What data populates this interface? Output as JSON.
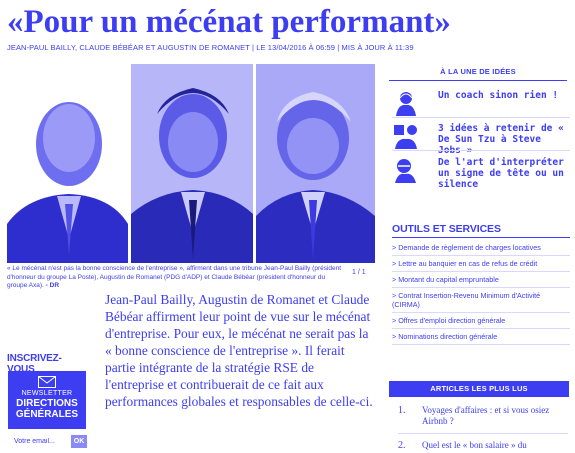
{
  "article": {
    "title": "«Pour un mécénat performant»",
    "authors": "JEAN-PAUL BAILLY, CLAUDE BÉBÉAR ET AUGUSTIN DE ROMANET |",
    "published": "LE 13/04/2016 À 06:59 | MIS À JOUR À 11:39",
    "caption": "« Le mécénat n'est pas la bonne conscience de l'entreprise », affirment dans une tribune Jean-Paul Bailly (président d'honneur du groupe La Poste), Augustin de Romanet (PDG d'ADP) et Claude Bébéar (président d'honneur du groupe Axa).",
    "caption_credit": "- DR",
    "photo_counter": "1 / 1",
    "body": "Jean-Paul Bailly, Augustin de Romanet et Claude Bébéar affirment leur point de vue sur le mécénat d'entreprise. Pour eux, le mécénat ne serait pas la « bonne conscience de l'entreprise ». Il ferait partie intégrante de la stratégie RSE de l'entreprise et contribuerait de ce fait aux performances globales et responsables de celle-ci."
  },
  "newsletter": {
    "heading": "INSCRIVEZ-VOUS",
    "label": "NEWSLETTER",
    "name_line1": "DIRECTIONS",
    "name_line2": "GÉNÉRALES",
    "placeholder": "Votre email...",
    "submit_label": "OK"
  },
  "ideas": {
    "heading": "À LA UNE DE IDÉES",
    "items": [
      {
        "title": "Un coach sinon rien !"
      },
      {
        "title": "3 idées à retenir de « De Sun Tzu à Steve Jobs »"
      },
      {
        "title": "De l'art d'interpréter un signe de tête ou un silence"
      }
    ]
  },
  "tools": {
    "heading": "OUTILS ET SERVICES",
    "items": [
      "> Demande de règlement de charges locatives",
      "> Lettre au banquier en cas de refus de crédit",
      "> Montant du capital empruntable",
      "> Contrat Insertion-Revenu Minimum d'Activité (CIRMA)",
      "> Offres d'emploi direction générale",
      "> Nominations direction générale"
    ]
  },
  "most_read": {
    "heading": "ARTICLES LES PLUS LUS",
    "items": [
      {
        "num": "1.",
        "title": "Voyages d'affaires : et si vous osiez Airbnb ?"
      },
      {
        "num": "2.",
        "title": "Quel est le « bon salaire » du"
      }
    ]
  },
  "colors": {
    "accent": "#3d3df2",
    "light": "#d9d9ff",
    "button": "#8a8af5"
  }
}
